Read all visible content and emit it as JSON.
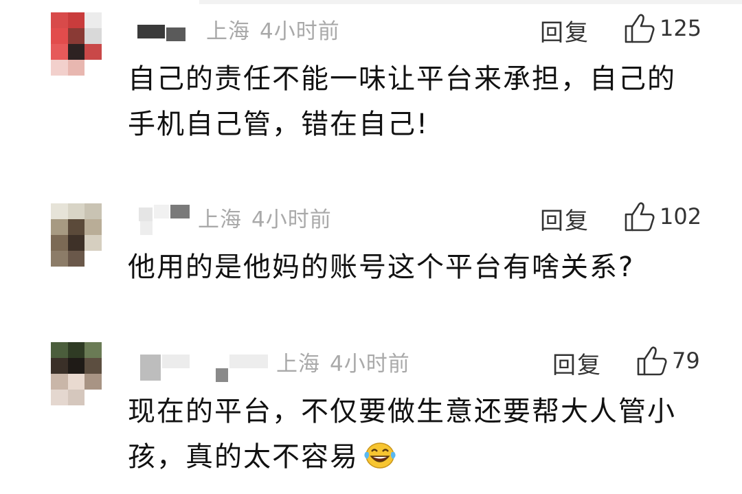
{
  "comments": [
    {
      "location": "上海",
      "time": "4小时前",
      "reply_label": "回复",
      "likes": "125",
      "text": "自己的责任不能一味让平台来承担，自己的手机自己管，错在自己!"
    },
    {
      "location": "上海",
      "time": "4小时前",
      "reply_label": "回复",
      "likes": "102",
      "text": "他用的是他妈的账号这个平台有啥关系?"
    },
    {
      "location": "上海",
      "time": "4小时前",
      "reply_label": "回复",
      "likes": "79",
      "text": "现在的平台，不仅要做生意还要帮大人管小孩，真的太不容易"
    }
  ],
  "icons": {
    "like": "thumbs-up-icon",
    "emoji": "laughing-tears-emoji"
  },
  "colors": {
    "meta_text": "#a9a9a9",
    "body_text": "#111111",
    "action_text": "#333333"
  }
}
